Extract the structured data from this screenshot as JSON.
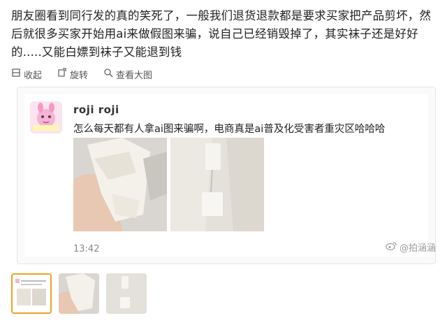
{
  "post": {
    "text": "朋友圈看到同行发的真的笑死了，一般我们退货退款都是要求买家把产品剪坏，然后就很多买家开始用ai来做假图来骗，说自己已经销毁掉了，其实袜子还是好好的.....又能白嫖到袜子又能退到钱"
  },
  "toolbar": {
    "collect_label": "收起",
    "rotate_label": "旋转",
    "view_large_label": "查看大图"
  },
  "card": {
    "username": "roji roji",
    "message": "怎么每天都有人拿ai图来骗啊，电商真是ai普及化受害者重灾区哈哈哈",
    "time": "13:42"
  },
  "watermark": "@拍涵涵",
  "colors": {
    "active_thumb_border": "#f0a024",
    "text": "#222222",
    "muted": "#888888"
  },
  "icons": [
    "collapse-icon",
    "rotate-icon",
    "search-icon",
    "weibo-icon"
  ]
}
